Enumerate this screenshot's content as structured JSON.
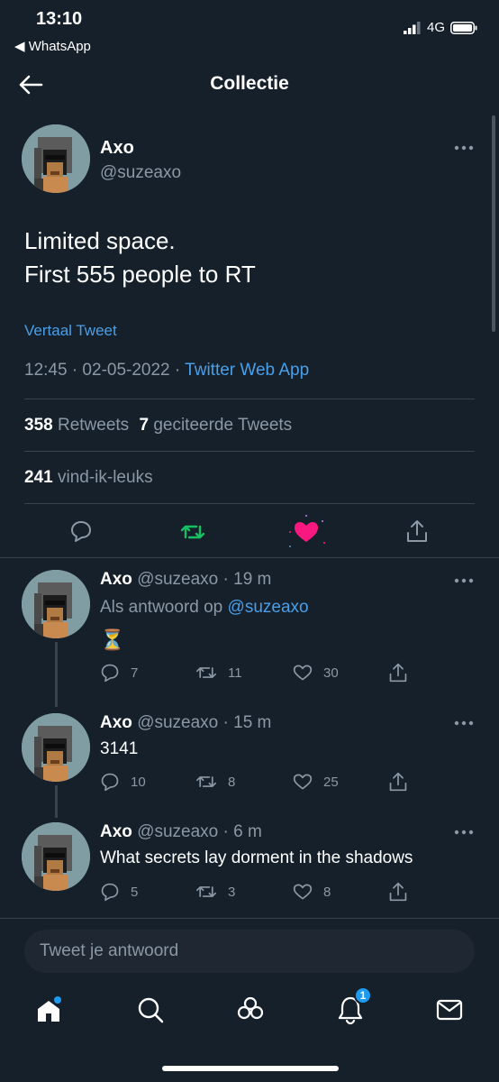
{
  "status_bar": {
    "time": "13:10",
    "back_app": "◀ WhatsApp",
    "network": "4G"
  },
  "nav": {
    "title": "Collectie"
  },
  "main_tweet": {
    "name": "Axo",
    "handle": "@suzeaxo",
    "text_line1": "Limited space.",
    "text_line2": "First 555 people to RT",
    "translate": "Vertaal Tweet",
    "time": "12:45 · 02-05-2022 · ",
    "source": "Twitter Web App",
    "retweets_count": "358",
    "retweets_label": "Retweets",
    "quotes_count": "7",
    "quotes_label": "geciteerde Tweets",
    "likes_count": "241",
    "likes_label": "vind-ik-leuks"
  },
  "replies": [
    {
      "name": "Axo",
      "handle": "@suzeaxo",
      "time": "· 19 m",
      "reply_to_label": "Als antwoord op ",
      "reply_to_handle": "@suzeaxo",
      "text": "⏳",
      "replies": "7",
      "retweets": "11",
      "likes": "30"
    },
    {
      "name": "Axo",
      "handle": "@suzeaxo",
      "time": "· 15 m",
      "text": "3141",
      "replies": "10",
      "retweets": "8",
      "likes": "25"
    },
    {
      "name": "Axo",
      "handle": "@suzeaxo",
      "time": "· 6 m",
      "text": "What secrets lay dorment in the shadows",
      "replies": "5",
      "retweets": "3",
      "likes": "8"
    }
  ],
  "reply_box": {
    "placeholder": "Tweet je antwoord"
  },
  "tab_bar": {
    "notifications_badge": "1"
  },
  "colors": {
    "background": "#15202b",
    "accent": "#1d9bf0",
    "retweet": "#17bf63",
    "like": "#f91880"
  }
}
